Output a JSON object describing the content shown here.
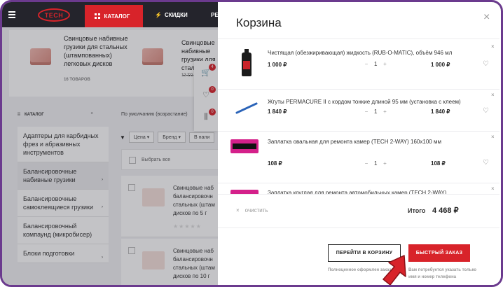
{
  "header": {
    "logo_text": "TECH",
    "nav": {
      "catalog": "КАТАЛОГ",
      "sales": "СКИДКИ",
      "more": "РЕ"
    }
  },
  "featured": [
    {
      "title": "Свинцовые набивные грузики для стальных (штампованных) легковых дисков",
      "count": "16 ТОВАРОВ"
    },
    {
      "title": "Свинцовые набивные грузики для стальны легковых",
      "count": "12 ТО"
    }
  ],
  "sidebar": {
    "heading": "КАТАЛОГ",
    "items": [
      {
        "label": "Адаптеры для карбидных фрез и абразивных инструментов",
        "active": false,
        "arrow": ""
      },
      {
        "label": "Балансировочные набивные грузики",
        "active": true,
        "arrow": "›"
      },
      {
        "label": "Балансировочные самоклеящиеся грузики",
        "active": false,
        "arrow": "›"
      },
      {
        "label": "Балансировочный компаунд (микробисер)",
        "active": false,
        "arrow": ""
      },
      {
        "label": "Блоки подготовки",
        "active": false,
        "arrow": "›"
      }
    ]
  },
  "listing": {
    "sort": "По умолчанию (возрастание)",
    "filters": [
      "Цена",
      "Бренд",
      "В нали"
    ],
    "select_all": "Выбрать все",
    "products": [
      {
        "text": "Свинцовые наб балансировочн стальных (штам дисков по 5 г"
      },
      {
        "text": "Свинцовые наб балансировочн стальных (штам дисков по 10 г"
      }
    ]
  },
  "float_badges": {
    "cart": "4",
    "wishlist": "0",
    "compare": "0"
  },
  "cart": {
    "title": "Корзина",
    "items": [
      {
        "name": "Чистящая (обезжиривающая) жидкость (RUB-O-MATIC), объём 946 мл",
        "price": "1 000 ₽",
        "qty": "1",
        "total": "1 000 ₽",
        "image": "bottle"
      },
      {
        "name": "Жгуты PERMACURE II с кордом тонкие длиной 95 мм (установка с клеем)",
        "price": "1 840 ₽",
        "qty": "1",
        "total": "1 840 ₽",
        "image": "cord"
      },
      {
        "name": "Заплатка овальная для ремонта камер (TECH 2-WAY) 160x100 мм",
        "price": "108 ₽",
        "qty": "1",
        "total": "108 ₽",
        "image": "patch"
      },
      {
        "name": "Заплатка круглая для ремонта автомобильных камер (TECH 2-WAY)",
        "price": "",
        "qty": "",
        "total": "",
        "image": "patch"
      }
    ],
    "clear_label": "очистить",
    "total_label": "Итого",
    "total_value": "4 468 ₽",
    "goto_cart_label": "ПЕРЕЙТИ В КОРЗИНУ",
    "goto_cart_hint": "Полноценное оформлен заказа",
    "quick_order_label": "БЫСТРЫЙ ЗАКАЗ",
    "quick_order_hint": "Вам потребуется указать только имя и номер телефона"
  },
  "colors": {
    "brand_red": "#d8232a",
    "header_bg": "#24242c",
    "frame": "#6b3a8e"
  }
}
